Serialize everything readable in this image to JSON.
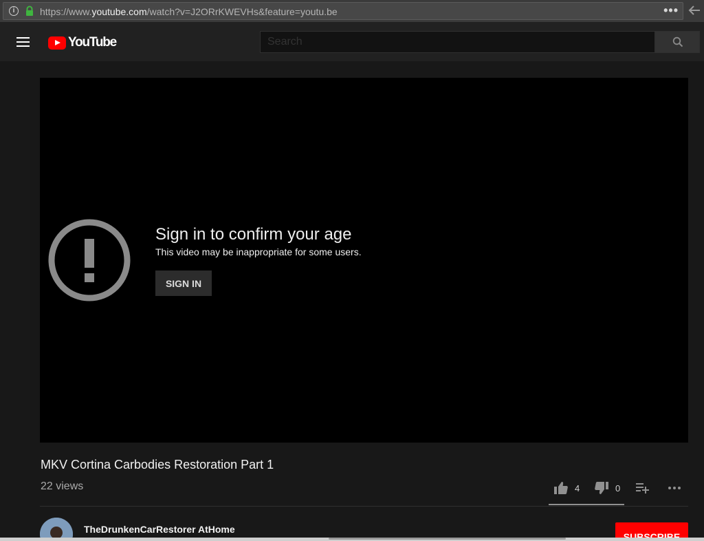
{
  "browser": {
    "url_scheme": "https://www.",
    "url_host": "youtube.com",
    "url_path": "/watch?v=J2ORrKWEVHs&feature=youtu.be",
    "more_label": "•••"
  },
  "masthead": {
    "logo_text": "YouTube",
    "search_placeholder": "Search"
  },
  "player": {
    "age_title": "Sign in to confirm your age",
    "age_subtitle": "This video may be inappropriate for some users.",
    "signin_label": "SIGN IN"
  },
  "video": {
    "title": "MKV Cortina Carbodies Restoration Part 1",
    "views": "22 views",
    "likes": "4",
    "dislikes": "0"
  },
  "channel": {
    "name": "TheDrunkenCarRestorer AtHome",
    "subscribe_label": "SUBSCRIBE"
  },
  "colors": {
    "background": "#181818",
    "masthead": "#212121",
    "brand_red": "#ff0000",
    "lock_green": "#3fb53f"
  },
  "icons": [
    "info-icon",
    "lock-icon",
    "more-icon",
    "back-icon",
    "menu-icon",
    "search-icon",
    "alert-icon",
    "thumb-up-icon",
    "thumb-down-icon",
    "add-to-playlist-icon",
    "more-actions-icon"
  ]
}
